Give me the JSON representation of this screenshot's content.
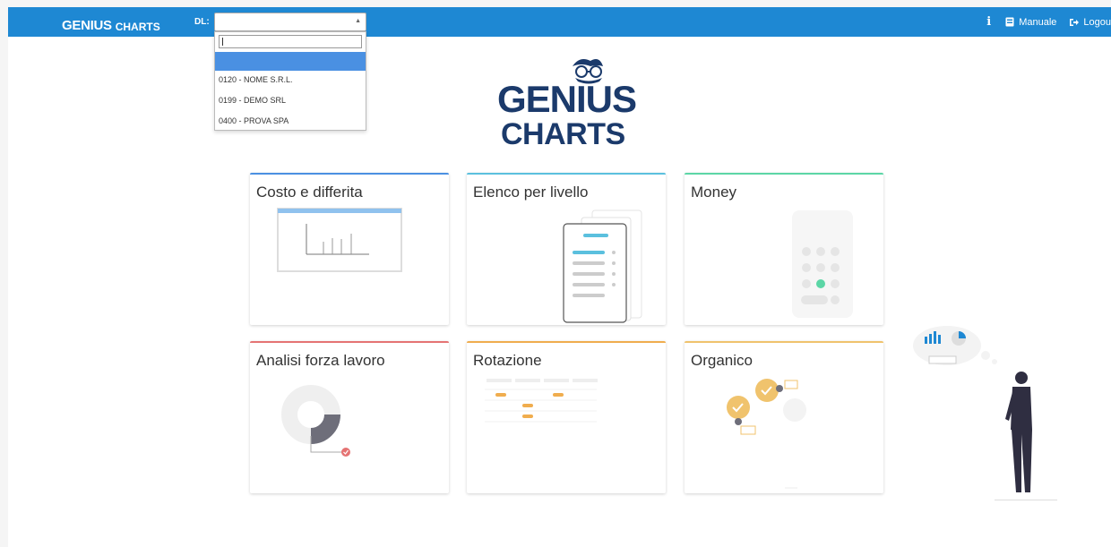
{
  "header": {
    "brand_main": "GENIUS",
    "brand_sub": "CHARTS",
    "dl_label": "DL:",
    "manuale_label": "Manuale",
    "logout_label": "Logou"
  },
  "dropdown": {
    "search_value": "",
    "options": [
      "0120 - NOME S.R.L.",
      "0199 - DEMO SRL",
      "0400 - PROVA SPA"
    ]
  },
  "logo": {
    "word1": "GENIUS",
    "word2": "CHARTS"
  },
  "cards": [
    {
      "title": "Costo e differita",
      "accent": "#4a90e2"
    },
    {
      "title": "Elenco per livello",
      "accent": "#5bc0de"
    },
    {
      "title": "Money",
      "accent": "#5cd6a6"
    },
    {
      "title": "Analisi forza lavoro",
      "accent": "#e57373"
    },
    {
      "title": "Rotazione",
      "accent": "#f0ad4e"
    },
    {
      "title": "Organico",
      "accent": "#f0c36d"
    }
  ],
  "colors": {
    "topbar": "#1e88d3",
    "logo": "#1b3a6b"
  }
}
